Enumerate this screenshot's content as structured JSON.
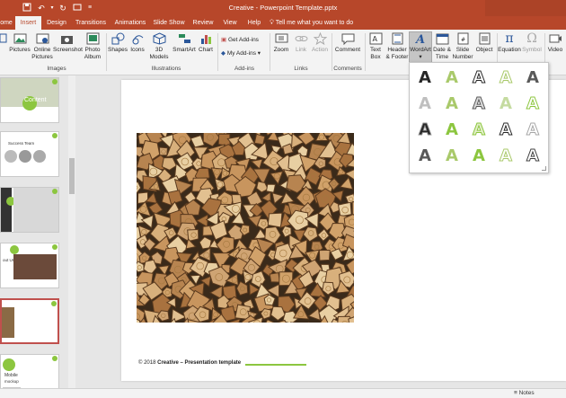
{
  "window": {
    "title": "Creative - Powerpoint Template.pptx",
    "accent": "#b7472a"
  },
  "quick_access": {
    "icons": [
      "save-icon",
      "undo-icon",
      "redo-icon",
      "present-icon",
      "customize-icon"
    ]
  },
  "tabs": [
    {
      "label": "ome"
    },
    {
      "label": "Insert",
      "active": true
    },
    {
      "label": "Design"
    },
    {
      "label": "Transitions"
    },
    {
      "label": "Animations"
    },
    {
      "label": "Slide Show"
    },
    {
      "label": "Review"
    },
    {
      "label": "View"
    },
    {
      "label": "Help"
    }
  ],
  "tell_me": "Tell me what you want to do",
  "ribbon": {
    "images": {
      "group_label": "Images",
      "pictures": "Pictures",
      "online_pictures_1": "Online",
      "online_pictures_2": "Pictures",
      "screenshot": "Screenshot",
      "photo_album_1": "Photo",
      "photo_album_2": "Album"
    },
    "illustrations": {
      "group_label": "Illustrations",
      "shapes": "Shapes",
      "icons": "Icons",
      "models_1": "3D",
      "models_2": "Models",
      "smartart": "SmartArt",
      "chart": "Chart"
    },
    "addins": {
      "group_label": "Add-ins",
      "get_addins": "Get Add-ins",
      "my_addins": "My Add-ins"
    },
    "links": {
      "group_label": "Links",
      "zoom": "Zoom",
      "link": "Link",
      "action": "Action"
    },
    "comments": {
      "group_label": "Comments",
      "comment": "Comment"
    },
    "text": {
      "textbox_1": "Text",
      "textbox_2": "Box",
      "header_1": "Header",
      "header_2": "& Footer",
      "wordart": "WordArt",
      "datetime_1": "Date &",
      "datetime_2": "Time",
      "slidenum_1": "Slide",
      "slidenum_2": "Number",
      "object": "Object"
    },
    "symbols": {
      "equation": "Equation",
      "symbol": "Symbol"
    },
    "media": {
      "video": "Video"
    }
  },
  "thumbnails": [
    {
      "title": "Content"
    },
    {
      "title": "Success Team"
    },
    {
      "title": ""
    },
    {
      "title": "out Us"
    },
    {
      "title": "",
      "selected": true
    },
    {
      "title_1": "Mobile",
      "title_2": "mockup"
    }
  ],
  "wordart_gallery": {
    "letter": "A",
    "styles": [
      {
        "fill": "#262626",
        "stroke": "none"
      },
      {
        "fill": "#a9c96a",
        "stroke": "none"
      },
      {
        "fill": "#ffffff",
        "stroke": "#262626"
      },
      {
        "fill": "#ffffff",
        "stroke": "#a9c96a"
      },
      {
        "fill": "#595959",
        "stroke": "none"
      },
      {
        "fill": "#bfbfbf",
        "stroke": "none"
      },
      {
        "fill": "#a9c96a",
        "stroke": "none"
      },
      {
        "fill": "#d9d9d9",
        "stroke": "#595959"
      },
      {
        "fill": "#c5dba0",
        "stroke": "none"
      },
      {
        "fill": "#ffffff",
        "stroke": "#8cc63f"
      },
      {
        "fill": "#262626",
        "stroke": "#8c8c8c"
      },
      {
        "fill": "#8cc63f",
        "stroke": "none"
      },
      {
        "fill": "#e2efc9",
        "stroke": "#8cc63f"
      },
      {
        "fill": "#ffffff",
        "stroke": "#262626"
      },
      {
        "fill": "#ffffff",
        "stroke": "#a6a6a6"
      },
      {
        "fill": "#595959",
        "stroke": "none"
      },
      {
        "fill": "#a9c96a",
        "stroke": "none"
      },
      {
        "fill": "#8cc63f",
        "stroke": "none"
      },
      {
        "fill": "#ffffff",
        "stroke": "#a9c96a"
      },
      {
        "fill": "#ffffff",
        "stroke": "#404040"
      }
    ]
  },
  "slide": {
    "footer_year": "© 2018",
    "footer_brand": "Creative – Presentation template"
  },
  "status": {
    "notes": "Notes"
  },
  "colors": {
    "accent_green": "#8cc63f",
    "selection_red": "#c0504d"
  }
}
